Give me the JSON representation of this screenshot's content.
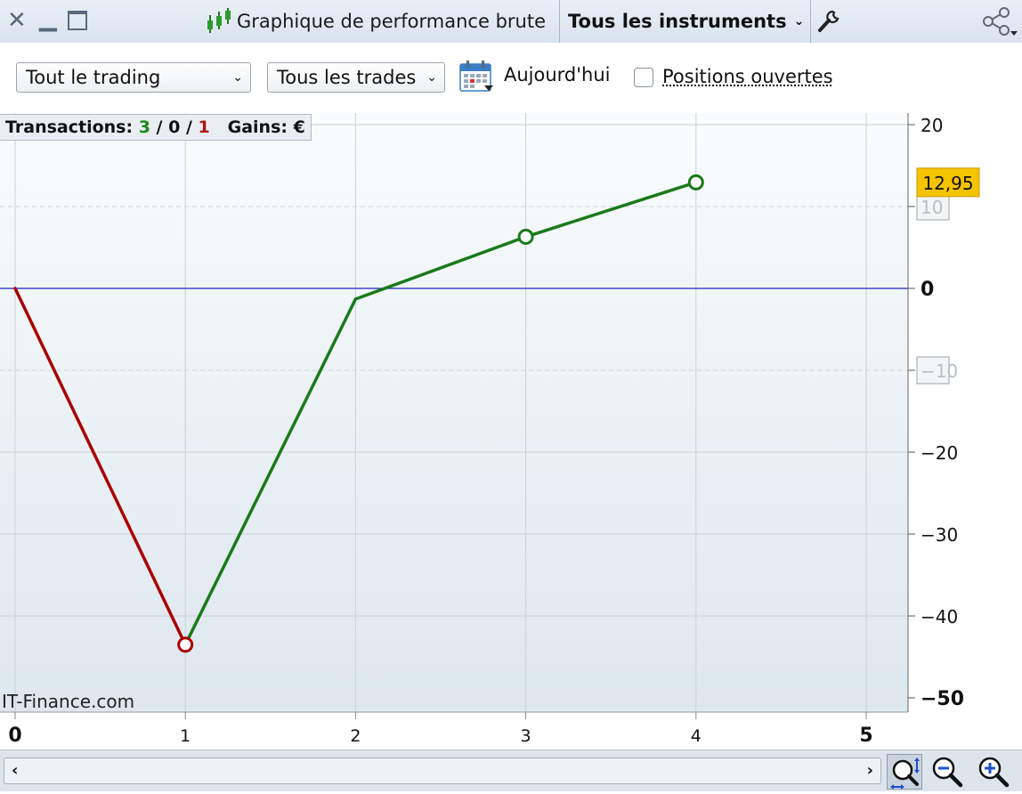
{
  "window": {
    "title": "Graphique de performance brute",
    "instruments_label": "Tous les instruments"
  },
  "toolbar": {
    "trading_select": "Tout le trading",
    "trades_select": "Tous les trades",
    "today_label": "Aujourd'hui",
    "open_positions_label": "Positions ouvertes"
  },
  "stats": {
    "transactions_label": "Transactions:",
    "wins": "3",
    "neutral": "0",
    "losses": "1",
    "gains_label": "Gains: €"
  },
  "watermark": "IT-Finance.com",
  "icons": [
    "close-icon",
    "minimize-icon",
    "maximize-icon",
    "candlestick-icon",
    "chevron-down-icon",
    "wrench-icon",
    "share-icon",
    "calendar-icon",
    "scroll-left-icon",
    "scroll-right-icon",
    "zoom-fit-icon",
    "zoom-out-icon",
    "zoom-in-icon"
  ],
  "colors": {
    "gain": "#1a7a1a",
    "loss": "#aa0000",
    "zero_line": "#2020c0",
    "last_value_badge": "#f5c400"
  },
  "chart_data": {
    "type": "line",
    "x": [
      0,
      1,
      2,
      3,
      4
    ],
    "y": [
      0,
      -43.5,
      -1.3,
      6.3,
      12.95
    ],
    "point_markers": [
      1,
      3,
      4
    ],
    "xlim": [
      0,
      5
    ],
    "ylim": [
      -50,
      20
    ],
    "x_ticks": [
      "0",
      "1",
      "2",
      "3",
      "4",
      "5"
    ],
    "y_ticks": [
      "20",
      "10",
      "0",
      "−10",
      "−20",
      "−30",
      "−40",
      "−50"
    ],
    "last_value_label": "12,95",
    "grid": true
  }
}
